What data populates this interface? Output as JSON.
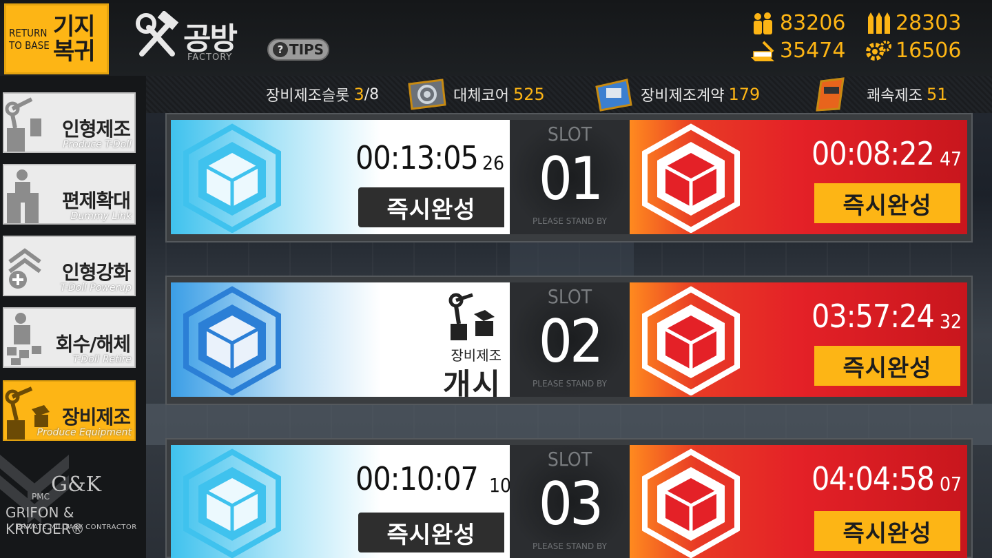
{
  "header": {
    "return_en": "RETURN TO BASE",
    "return_ko": "기지 복귀",
    "title_ko": "공방",
    "title_en": "FACTORY",
    "tips_label": "TIPS"
  },
  "resources": {
    "manpower": "83206",
    "ammo": "28303",
    "rations": "35474",
    "parts": "16506"
  },
  "info": {
    "slot_label": "장비제조슬롯",
    "slot_used": "3",
    "slot_total": "/8",
    "core_label": "대체코어",
    "core_value": "525",
    "contract_label": "장비제조계약",
    "contract_value": "179",
    "quick_label": "쾌속제조",
    "quick_value": "51"
  },
  "sidebar": {
    "items": [
      {
        "ko": "인형제조",
        "en": "Produce T-Doll"
      },
      {
        "ko": "편제확대",
        "en": "Dummy Link"
      },
      {
        "ko": "인형강화",
        "en": "T-Doll Powerup"
      },
      {
        "ko": "회수/해체",
        "en": "T-Doll Retire"
      },
      {
        "ko": "장비제조",
        "en": "Produce Equipment"
      }
    ],
    "logo": {
      "gk": "G&K",
      "pmc": "PMC",
      "name": "GRIFON & KRYUGER®",
      "sub": "PRIVATE MILITARY CONTRACTOR"
    }
  },
  "slots": [
    {
      "label": "SLOT",
      "number": "01",
      "standby": "PLEASE STAND BY",
      "left": {
        "timer": "00:13:05",
        "sub": "26",
        "button": "즉시완성"
      },
      "right": {
        "timer": "00:08:22",
        "sub": "47",
        "button": "즉시완성"
      }
    },
    {
      "label": "SLOT",
      "number": "02",
      "standby": "PLEASE STAND BY",
      "left": {
        "start_small": "장비제조",
        "start_big": "개시"
      },
      "right": {
        "timer": "03:57:24",
        "sub": "32",
        "button": "즉시완성"
      }
    },
    {
      "label": "SLOT",
      "number": "03",
      "standby": "PLEASE STAND BY",
      "left": {
        "timer": "00:10:07",
        "sub": "10",
        "button": "즉시완성"
      },
      "right": {
        "timer": "04:04:58",
        "sub": "07",
        "button": "즉시완성"
      }
    }
  ],
  "colors": {
    "accent": "#fdb515",
    "red_panel": "#e42127",
    "cyan_cube": "#3fc2ee",
    "blue_cube": "#2b7fd6"
  }
}
